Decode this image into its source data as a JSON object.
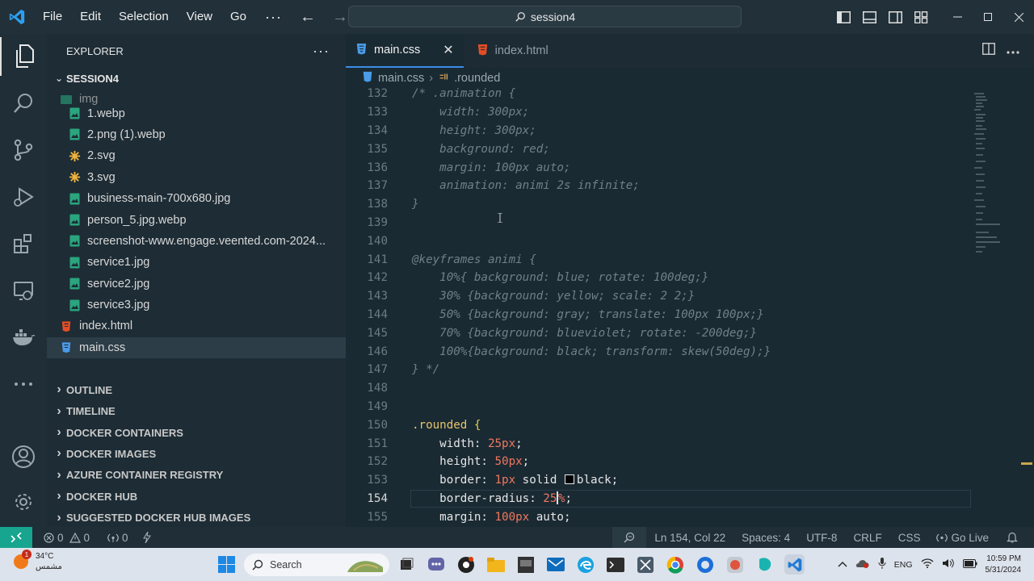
{
  "titlebar": {
    "menu": [
      "File",
      "Edit",
      "Selection",
      "View",
      "Go"
    ],
    "more": "···",
    "search_text": "session4",
    "back_arrow": "←",
    "forward_arrow": "→"
  },
  "sidebar": {
    "title": "EXPLORER",
    "more": "···",
    "folder": "SESSION4",
    "img_folder": "img",
    "files": [
      {
        "name": "1.webp",
        "icon": "image-file-icon"
      },
      {
        "name": "2.png (1).webp",
        "icon": "image-file-icon"
      },
      {
        "name": "2.svg",
        "icon": "svg-file-icon"
      },
      {
        "name": "3.svg",
        "icon": "svg-file-icon"
      },
      {
        "name": "business-main-700x680.jpg",
        "icon": "image-file-icon"
      },
      {
        "name": "person_5.jpg.webp",
        "icon": "image-file-icon"
      },
      {
        "name": "screenshot-www.engage.veented.com-2024...",
        "icon": "image-file-icon"
      },
      {
        "name": "service1.jpg",
        "icon": "image-file-icon"
      },
      {
        "name": "service2.jpg",
        "icon": "image-file-icon"
      },
      {
        "name": "service3.jpg",
        "icon": "image-file-icon"
      }
    ],
    "root_files": [
      {
        "name": "index.html",
        "icon": "html-file-icon"
      },
      {
        "name": "main.css",
        "icon": "css-file-icon"
      }
    ],
    "sections": [
      "OUTLINE",
      "TIMELINE",
      "DOCKER CONTAINERS",
      "DOCKER IMAGES",
      "AZURE CONTAINER REGISTRY",
      "DOCKER HUB",
      "SUGGESTED DOCKER HUB IMAGES"
    ]
  },
  "editor": {
    "tabs": [
      {
        "label": "main.css",
        "active": true
      },
      {
        "label": "index.html",
        "active": false
      }
    ],
    "close_glyph": "✕",
    "breadcrumb": {
      "file": "main.css",
      "symbol": ".rounded"
    },
    "lines": [
      {
        "n": "132",
        "text": "/* .animation {"
      },
      {
        "n": "133",
        "text": "    width: 300px;"
      },
      {
        "n": "134",
        "text": "    height: 300px;"
      },
      {
        "n": "135",
        "text": "    background: red;"
      },
      {
        "n": "136",
        "text": "    margin: 100px auto;"
      },
      {
        "n": "137",
        "text": "    animation: animi 2s infinite;"
      },
      {
        "n": "138",
        "text": "}"
      },
      {
        "n": "139",
        "text": ""
      },
      {
        "n": "140",
        "text": ""
      },
      {
        "n": "141",
        "text": "@keyframes animi {"
      },
      {
        "n": "142",
        "text": "    10%{ background: blue; rotate: 100deg;}"
      },
      {
        "n": "143",
        "text": "    30% {background: yellow; scale: 2 2;}"
      },
      {
        "n": "144",
        "text": "    50% {background: gray; translate: 100px 100px;}"
      },
      {
        "n": "145",
        "text": "    70% {background: blueviolet; rotate: -200deg;}"
      },
      {
        "n": "146",
        "text": "    100%{background: black; transform: skew(50deg);}"
      },
      {
        "n": "147",
        "text": "} */"
      },
      {
        "n": "148",
        "text": ""
      },
      {
        "n": "149",
        "text": ""
      }
    ],
    "code_lines": {
      "l150": {
        "n": "150",
        "sel": ".rounded",
        "brace": "{"
      },
      "l151": {
        "n": "151",
        "prop": "    width: ",
        "val": "25px",
        "end": ";"
      },
      "l152": {
        "n": "152",
        "prop": "    height: ",
        "val": "50px",
        "end": ";"
      },
      "l153": {
        "n": "153",
        "prop": "    border: ",
        "val": "1px",
        "mid": " solid ",
        "color": "black",
        "end": ";"
      },
      "l154": {
        "n": "154",
        "prop": "    border-radius: ",
        "val_a": "25",
        "val_b": "%",
        "end": ";"
      },
      "l155": {
        "n": "155",
        "prop": "    margin: ",
        "val": "100px",
        "mid": " auto",
        "end": ";"
      }
    }
  },
  "statusbar": {
    "errors": "0",
    "warnings": "0",
    "ports": "0",
    "position": "Ln 154, Col 22",
    "spaces": "Spaces: 4",
    "encoding": "UTF-8",
    "eol": "CRLF",
    "language": "CSS",
    "golive": "Go Live"
  },
  "taskbar": {
    "temperature": "34°C",
    "weather_label": "مشمس",
    "badge": "1",
    "search": "Search",
    "lang": "ENG",
    "time": "10:59 PM",
    "date": "5/31/2024"
  },
  "colors": {
    "accent": "#3c8ce7",
    "remote": "#17a58f",
    "comment": "#6f8088",
    "number": "#f0775e",
    "selector": "#e7c46b"
  }
}
